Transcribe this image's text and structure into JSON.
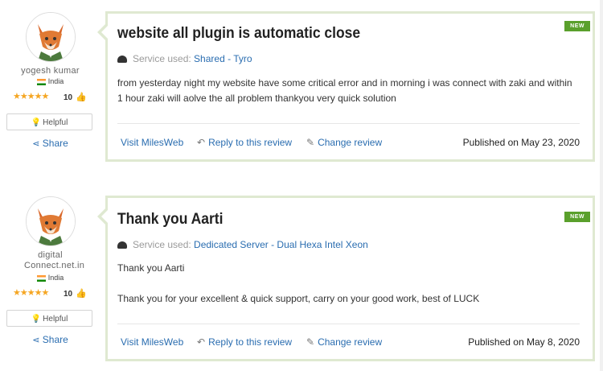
{
  "reviews": [
    {
      "user": {
        "name": "yogesh kumar",
        "country": "India",
        "score": "10",
        "helpful_label": "Helpful",
        "share_label": "Share",
        "stars": "★★★★★"
      },
      "badge": "NEW",
      "title": "website all plugin is automatic close",
      "service_label": "Service used:",
      "service_value": "Shared - Tyro",
      "body": [
        "from yesterday night my website have some critical error and in morning i was connect with zaki and within 1 hour zaki will aolve the all problem thankyou very quick solution"
      ],
      "actions": {
        "visit": "Visit MilesWeb",
        "reply": "Reply to this review",
        "change": "Change review",
        "published": "Published on May 23, 2020"
      }
    },
    {
      "user": {
        "name": "digital Connect.net.in",
        "country": "India",
        "score": "10",
        "helpful_label": "Helpful",
        "share_label": "Share",
        "stars": "★★★★★"
      },
      "badge": "NEW",
      "title": "Thank you Aarti",
      "service_label": "Service used:",
      "service_value": "Dedicated Server - Dual Hexa Intel Xeon",
      "body": [
        "Thank you Aarti",
        "Thank you for your excellent & quick support, carry on your good work, best of LUCK"
      ],
      "actions": {
        "visit": "Visit MilesWeb",
        "reply": "Reply to this review",
        "change": "Change review",
        "published": "Published on May 8, 2020"
      }
    }
  ],
  "colors": {
    "link": "#2a6db0",
    "badge": "#5aa02c",
    "card_border": "#dfe9d1",
    "star": "#f5a623"
  }
}
